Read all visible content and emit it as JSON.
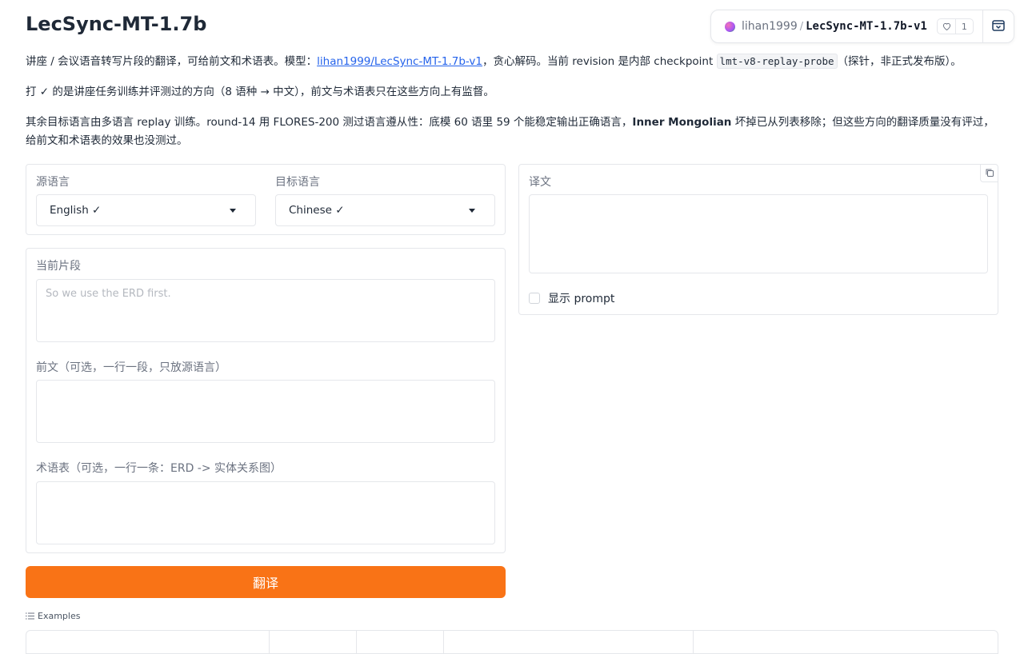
{
  "app": {
    "title": "LecSync-MT-1.7b"
  },
  "space": {
    "owner": "lihan1999",
    "separator": "/",
    "name": "LecSync-MT-1.7b-v1",
    "likes": "1"
  },
  "description": {
    "p1_a": "讲座 / 会议语音转写片段的翻译，可给前文和术语表。模型：",
    "p1_link": "lihan1999/LecSync-MT-1.7b-v1",
    "p1_b": "，贪心解码。当前 revision 是内部 checkpoint ",
    "p1_code": "lmt-v8-replay-probe",
    "p1_c": "（探针，非正式发布版）。",
    "p2": "打 ✓ 的是讲座任务训练并评测过的方向（8 语种 → 中文），前文与术语表只在这些方向上有监督。",
    "p3_a": "其余目标语言由多语言 replay 训练。round-14 用 FLORES-200 测过语言遵从性：底模 60 语里 59 个能稳定输出正确语言，",
    "p3_bold": "Inner Mongolian",
    "p3_b": " 坏掉已从列表移除；但这些方向的翻译质量没有评过，给前文和术语表的效果也没测过。"
  },
  "languages": {
    "source_label": "源语言",
    "source_value": "English ✓",
    "target_label": "目标语言",
    "target_value": "Chinese ✓"
  },
  "inputs": {
    "segment_label": "当前片段",
    "segment_placeholder": "So we use the ERD first.",
    "context_label": "前文（可选，一行一段，只放源语言）",
    "glossary_label": "术语表（可选，一行一条：ERD -> 实体关系图）"
  },
  "output": {
    "label": "译文",
    "show_prompt_label": "显示 prompt"
  },
  "actions": {
    "translate_label": "翻译"
  },
  "examples": {
    "header": "Examples"
  }
}
